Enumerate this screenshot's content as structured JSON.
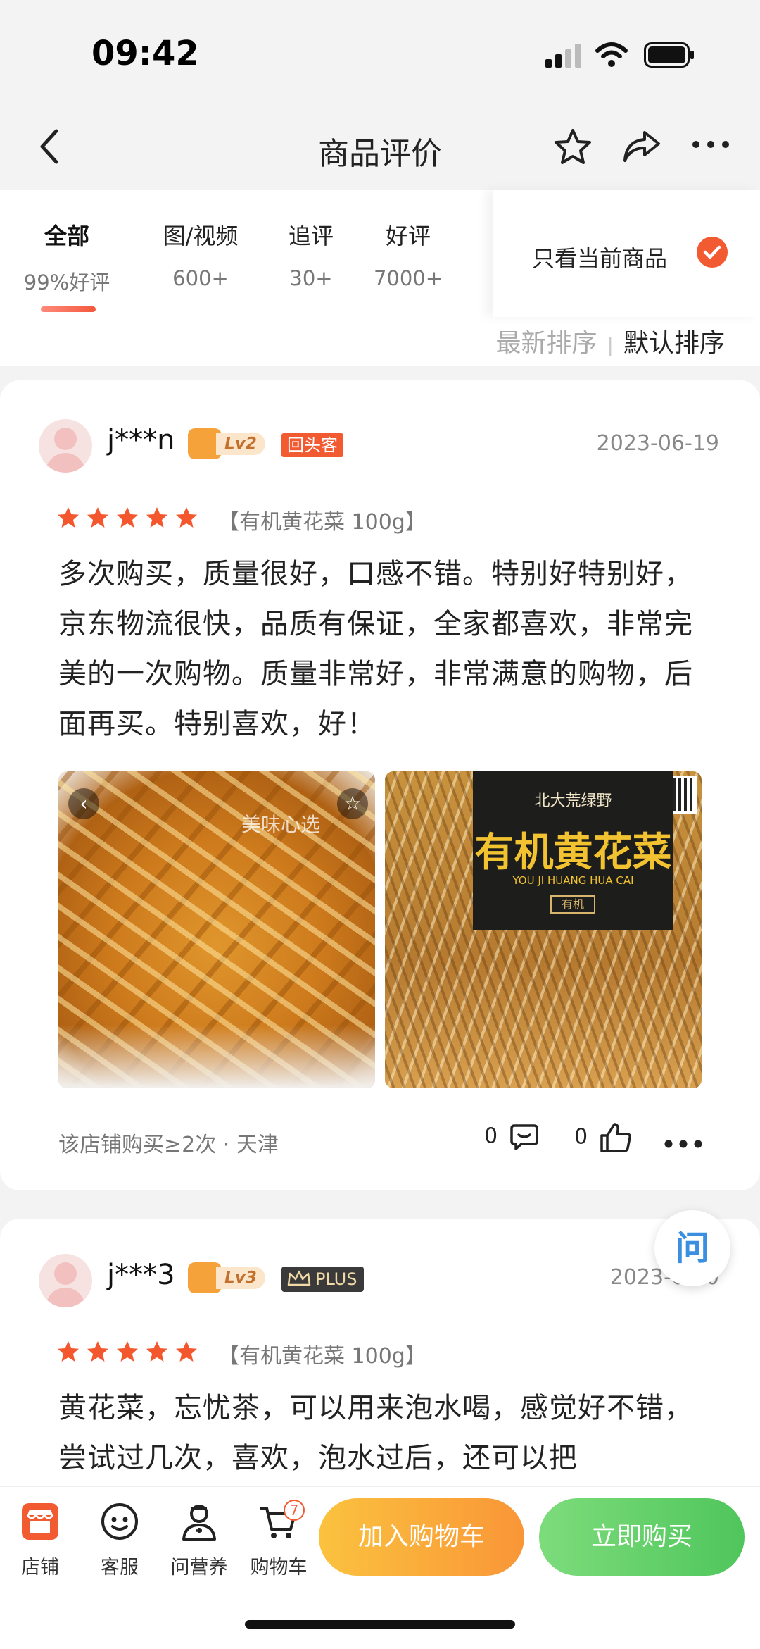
{
  "status_bar": {
    "time": "09:42"
  },
  "nav": {
    "title": "商品评价"
  },
  "filters": {
    "tabs": [
      {
        "label": "全部",
        "sub": "99%好评"
      },
      {
        "label": "图/视频",
        "sub": "600+"
      },
      {
        "label": "追评",
        "sub": "30+"
      },
      {
        "label": "好评",
        "sub": "7000+"
      }
    ],
    "only_current_label": "只看当前商品",
    "only_current_checked": true,
    "sort_latest": "最新排序",
    "sort_default": "默认排序"
  },
  "reviews": [
    {
      "user": "j***n",
      "level": "Lv2",
      "badge": "回头客",
      "date": "2023-06-19",
      "rating": 5,
      "spec": "【有机黄花菜 100g】",
      "content": "多次购买，质量很好，口感不错。特别好特别好，京东物流很快，品质有保证，全家都喜欢，非常完美的一次购物。质量非常好，非常满意的购物，后面再买。特别喜欢，好！",
      "image_watermark": "美味心选",
      "product_brand": "北大荒绿野",
      "product_name": "有机黄花菜",
      "product_pinyin": "YOU JI HUANG HUA CAI",
      "product_tag": "有机",
      "meta": "该店铺购买≥2次 · 天津",
      "comments": "0",
      "likes": "0"
    },
    {
      "user": "j***3",
      "level": "Lv3",
      "badge": "PLUS",
      "date": "2023-07-0",
      "rating": 5,
      "spec": "【有机黄花菜 100g】",
      "content": "黄花菜，忘忧茶，可以用来泡水喝，感觉好不错，尝试过几次，喜欢，泡水过后，还可以把"
    }
  ],
  "ask_button": "问",
  "bottom_bar": {
    "items": [
      {
        "label": "店铺"
      },
      {
        "label": "客服"
      },
      {
        "label": "问营养"
      },
      {
        "label": "购物车"
      }
    ],
    "cart_count": "7",
    "add_to_cart": "加入购物车",
    "buy_now": "立即购买"
  },
  "colors": {
    "accent": "#f25a32",
    "star": "#f4572e",
    "add_btn": "#f99637",
    "buy_btn": "#4fc65c"
  }
}
